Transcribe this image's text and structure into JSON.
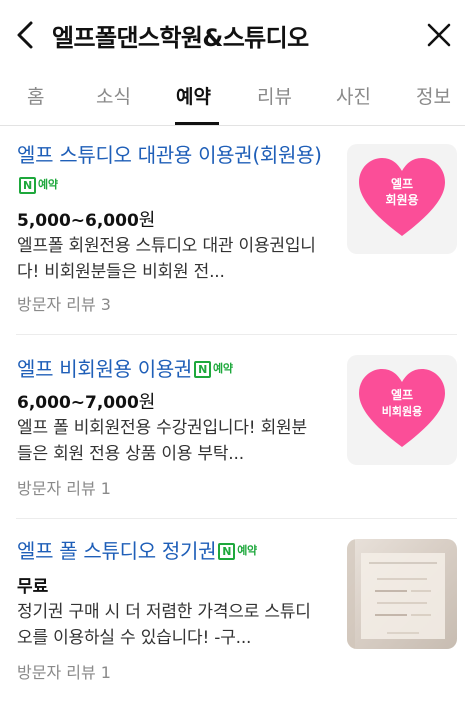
{
  "header": {
    "title": "엘프폴댄스학원&스튜디오"
  },
  "tabs": [
    {
      "label": "홈"
    },
    {
      "label": "소식"
    },
    {
      "label": "예약"
    },
    {
      "label": "리뷰"
    },
    {
      "label": "사진"
    },
    {
      "label": "정보"
    }
  ],
  "items": [
    {
      "name": "엘프 스튜디오 대관용 이용권(회원용)",
      "badge": "예약",
      "price": "5,000~6,000",
      "price_unit": "원",
      "description": "엘프폴 회원전용 스튜디오 대관 이용권입니다! 비회원분들은 비회원 전...",
      "reviews": "방문자 리뷰 3",
      "thumb_text_1": "엘프",
      "thumb_text_2": "회원용"
    },
    {
      "name": "엘프 비회원용 이용권",
      "badge": "예약",
      "price": "6,000~7,000",
      "price_unit": "원",
      "description": "엘프 폴 비회원전용 수강권입니다! 회원분들은 회원 전용 상품 이용 부탁...",
      "reviews": "방문자 리뷰 1",
      "thumb_text_1": "엘프",
      "thumb_text_2": "비회원용"
    },
    {
      "name": "엘프 폴 스튜디오 정기권",
      "badge": "예약",
      "price": "무료",
      "description": "정기권 구매 시 더 저렴한 가격으로 스튜디오를 이용하실 수 있습니다! -구...",
      "reviews": "방문자 리뷰 1"
    }
  ],
  "colors": {
    "link_blue": "#1f5fb8",
    "naver_green": "#1ea83c",
    "heart_pink": "#fb4e98"
  }
}
